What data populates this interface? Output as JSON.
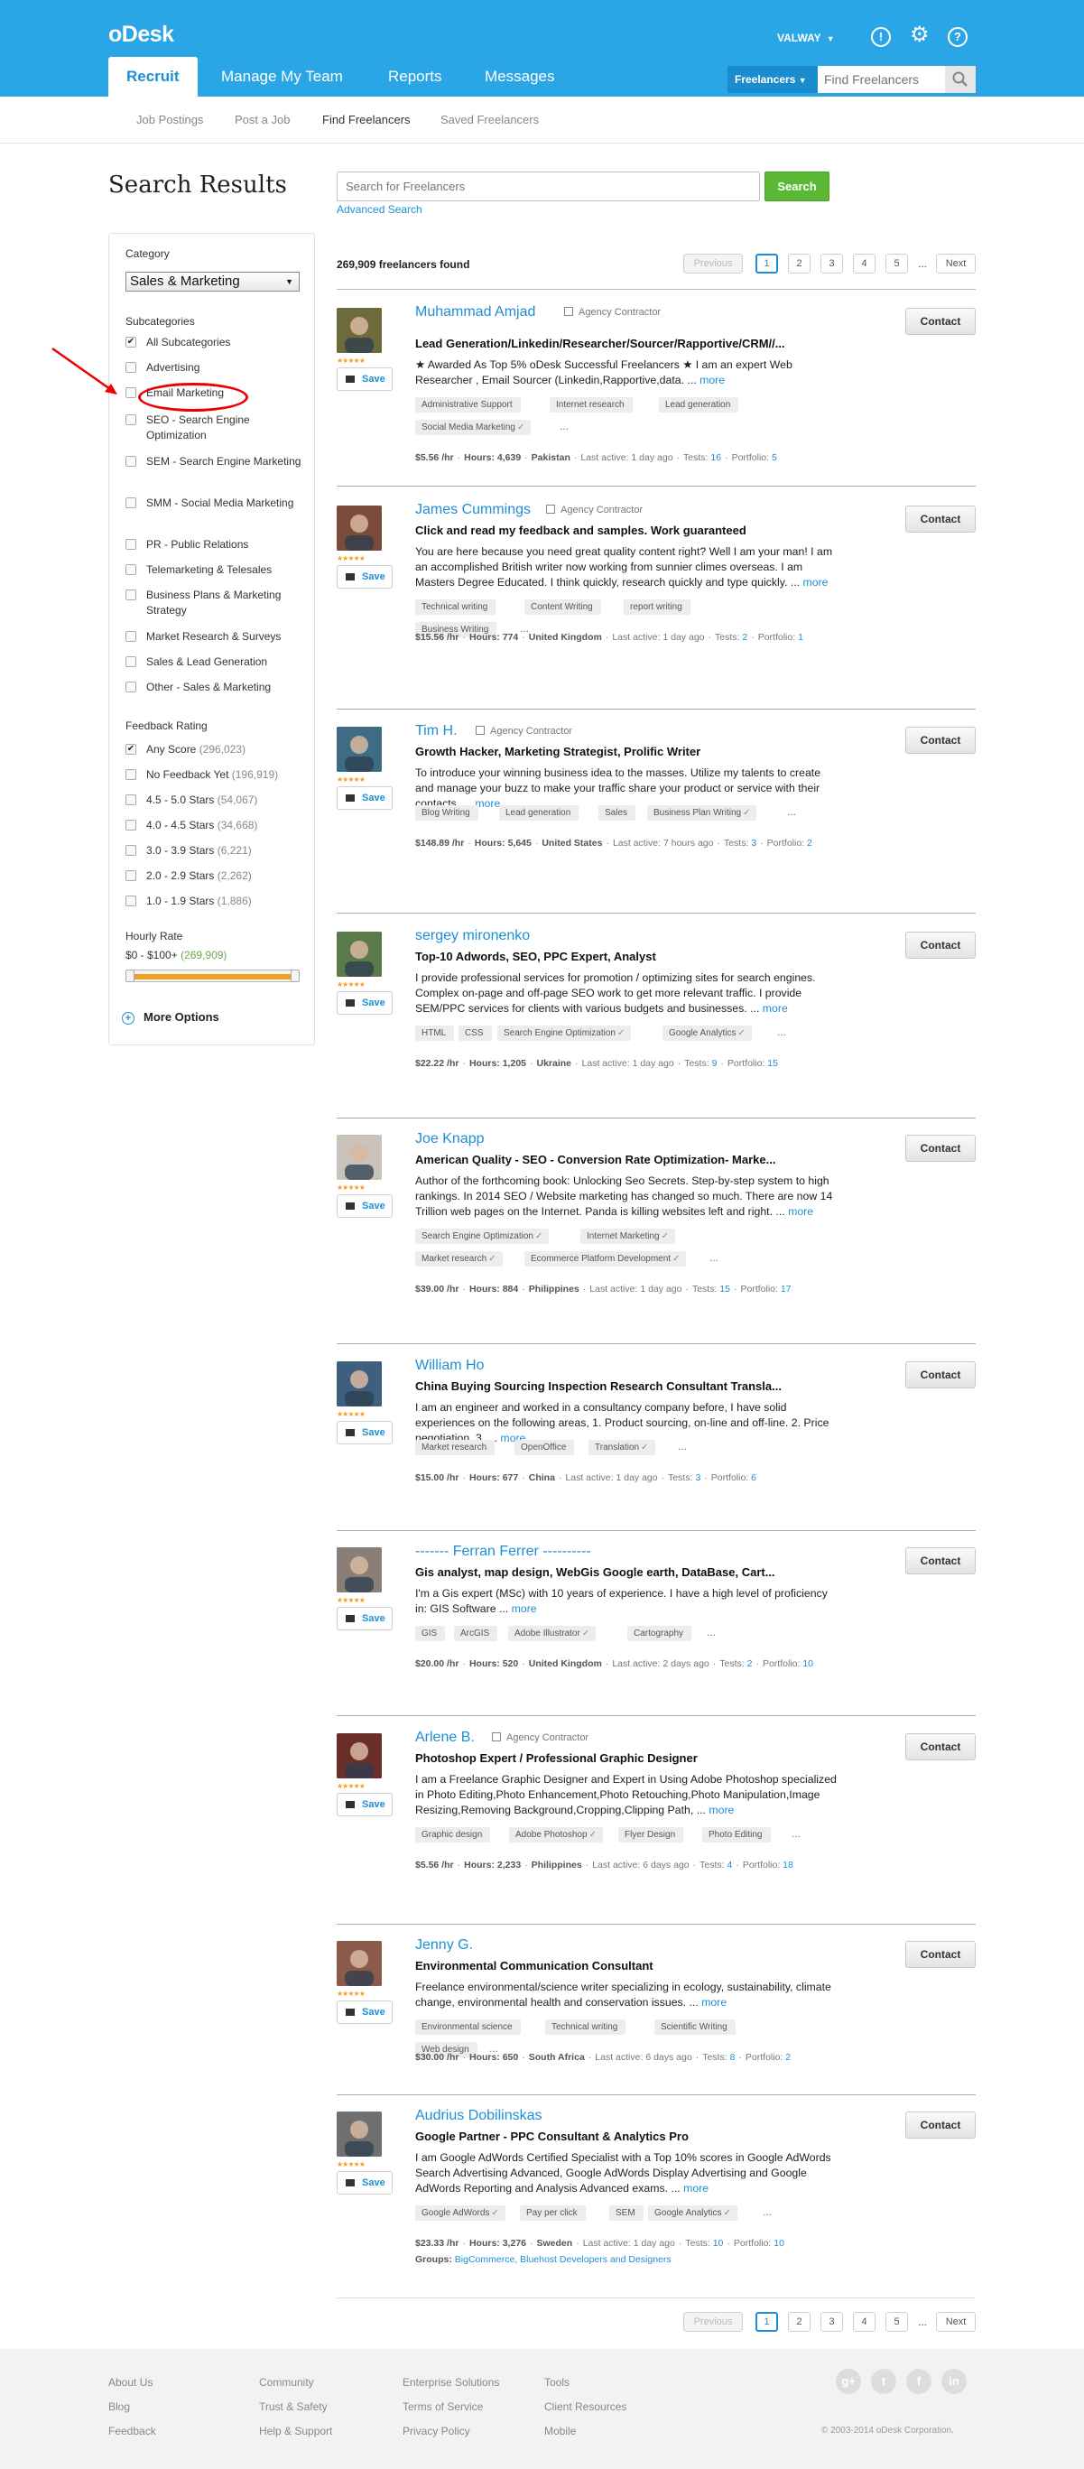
{
  "header": {
    "logo": "oDesk",
    "user": "VALWAY",
    "tabs": [
      "Recruit",
      "Manage My Team",
      "Reports",
      "Messages"
    ],
    "search_scope": "Freelancers",
    "search_placeholder": "Find Freelancers",
    "subnav": [
      "Job Postings",
      "Post a Job",
      "Find Freelancers",
      "Saved Freelancers"
    ]
  },
  "page": {
    "title": "Search Results",
    "search_placeholder": "Search for Freelancers",
    "search_button": "Search",
    "advanced": "Advanced Search",
    "found": "269,909 freelancers found"
  },
  "pagination": {
    "previous": "Previous",
    "pages": [
      "1",
      "2",
      "3",
      "4",
      "5"
    ],
    "ellipsis": "...",
    "next": "Next"
  },
  "sidebar": {
    "category_label": "Category",
    "category_value": "Sales & Marketing",
    "subcategories_label": "Subcategories",
    "subcategories": [
      {
        "label": "All Subcategories",
        "checked": "✔"
      },
      {
        "label": "Advertising",
        "checked": ""
      },
      {
        "label": "Email Marketing",
        "checked": ""
      },
      {
        "label": "SEO - Search Engine Optimization",
        "checked": ""
      },
      {
        "label": "SEM - Search Engine Marketing",
        "checked": ""
      },
      {
        "label": "SMM - Social Media Marketing",
        "checked": ""
      },
      {
        "label": "PR - Public Relations",
        "checked": ""
      },
      {
        "label": "Telemarketing & Telesales",
        "checked": ""
      },
      {
        "label": "Business Plans & Marketing Strategy",
        "checked": ""
      },
      {
        "label": "Market Research & Surveys",
        "checked": ""
      },
      {
        "label": "Sales & Lead Generation",
        "checked": ""
      },
      {
        "label": "Other - Sales & Marketing",
        "checked": ""
      }
    ],
    "feedback_label": "Feedback Rating",
    "feedback": [
      {
        "label": "Any Score",
        "count": "(296,023)",
        "checked": "✔"
      },
      {
        "label": "No Feedback Yet",
        "count": "(196,919)",
        "checked": ""
      },
      {
        "label": "4.5 - 5.0 Stars",
        "count": "(54,067)",
        "checked": ""
      },
      {
        "label": "4.0 - 4.5 Stars",
        "count": "(34,668)",
        "checked": ""
      },
      {
        "label": "3.0 - 3.9 Stars",
        "count": "(6,221)",
        "checked": ""
      },
      {
        "label": "2.0 - 2.9 Stars",
        "count": "(2,262)",
        "checked": ""
      },
      {
        "label": "1.0 - 1.9 Stars",
        "count": "(1,886)",
        "checked": ""
      }
    ],
    "hourly_label": "Hourly Rate",
    "hourly_range": "$0 - $100+",
    "hourly_count": "(269,909)",
    "more_options": "More Options"
  },
  "labels": {
    "save": "Save",
    "contact": "Contact",
    "stars": "★★★★★",
    "more": "more",
    "agency": "Agency Contractor",
    "hours": "Hours:",
    "last_active": "Last active:",
    "tests": "Tests:",
    "portfolio": "Portfolio:",
    "groups": "Groups:"
  },
  "results": [
    {
      "name": "Muhammad Amjad",
      "agency": true,
      "headline": "Lead Generation/Linkedin/Researcher/Sourcer/Rapportive/CRM//...",
      "desc": "★ Awarded As Top 5% oDesk Successful Freelancers ★ I am an expert Web Researcher , Email Sourcer (Linkedin,Rapportive,data. ...",
      "skills": [
        {
          "t": "Administrative Support",
          "c": ""
        },
        {
          "t": "Internet research",
          "c": ""
        },
        {
          "t": "Lead generation",
          "c": ""
        },
        {
          "t": "Social Media Marketing",
          "c": "✓"
        }
      ],
      "rate": "$5.56 /hr",
      "hours": "4,639",
      "country": "Pakistan",
      "active": "1 day ago",
      "tests": "16",
      "portfolio": "5",
      "groups": "",
      "groups_value": "",
      "avatar": "#6d6a3b"
    },
    {
      "name": "James Cummings",
      "agency": true,
      "headline": "Click and read my feedback and samples. Work guaranteed",
      "desc": "You are here because you need great quality content right? Well I am your man! I am an accomplished British writer now working from sunnier climes overseas. I am Masters Degree Educated. I think quickly, research quickly and type quickly. ...",
      "skills": [
        {
          "t": "Technical writing",
          "c": ""
        },
        {
          "t": "Content Writing",
          "c": ""
        },
        {
          "t": "report writing",
          "c": ""
        },
        {
          "t": "Business Writing",
          "c": ""
        }
      ],
      "rate": "$15.56 /hr",
      "hours": "774",
      "country": "United Kingdom",
      "active": "1 day ago",
      "tests": "2",
      "portfolio": "1",
      "groups": "",
      "groups_value": "",
      "avatar": "#7a4b3a"
    },
    {
      "name": "Tim H.",
      "agency": true,
      "headline": "Growth Hacker, Marketing Strategist, Prolific Writer",
      "desc": "To introduce your winning business idea to the masses. Utilize my talents to create and manage your buzz to make your traffic share your product or service with their contacts. ...",
      "skills": [
        {
          "t": "Blog Writing",
          "c": ""
        },
        {
          "t": "Lead generation",
          "c": ""
        },
        {
          "t": "Sales",
          "c": ""
        },
        {
          "t": "Business Plan Writing",
          "c": "✓"
        }
      ],
      "rate": "$148.89 /hr",
      "hours": "5,645",
      "country": "United States",
      "active": "7 hours ago",
      "tests": "3",
      "portfolio": "2",
      "groups": "",
      "groups_value": "",
      "avatar": "#3f6b84"
    },
    {
      "name": "sergey mironenko",
      "agency": false,
      "headline": "Top-10 Adwords, SEO, PPC Expert, Analyst",
      "desc": "I provide professional services for promotion / optimizing sites for search engines. Complex on-page and off-page SEO work to get more relevant traffic. I provide SEM/PPC services for clients with various budgets and businesses. ...",
      "skills": [
        {
          "t": "HTML",
          "c": ""
        },
        {
          "t": "CSS",
          "c": ""
        },
        {
          "t": "Search Engine Optimization",
          "c": "✓"
        },
        {
          "t": "Google Analytics",
          "c": "✓"
        }
      ],
      "rate": "$22.22 /hr",
      "hours": "1,205",
      "country": "Ukraine",
      "active": "1 day ago",
      "tests": "9",
      "portfolio": "15",
      "groups": "",
      "groups_value": "",
      "avatar": "#5b7a4a"
    },
    {
      "name": "Joe Knapp",
      "agency": false,
      "headline": "American Quality - SEO - Conversion Rate Optimization- Marke...",
      "desc": "Author of the forthcoming book: Unlocking Seo Secrets. Step-by-step system to high rankings. In 2014 SEO / Website marketing has changed so much. There are now 14 Trillion web pages on the Internet. Panda is killing websites left and right. ...",
      "skills": [
        {
          "t": "Search Engine Optimization",
          "c": "✓"
        },
        {
          "t": "Internet Marketing",
          "c": "✓"
        },
        {
          "t": "Market research",
          "c": "✓"
        },
        {
          "t": "Ecommerce Platform Development",
          "c": "✓"
        }
      ],
      "rate": "$39.00 /hr",
      "hours": "884",
      "country": "Philippines",
      "active": "1 day ago",
      "tests": "15",
      "portfolio": "17",
      "groups": "",
      "groups_value": "",
      "avatar": "#c9c3bb"
    },
    {
      "name": "William Ho",
      "agency": false,
      "headline": "China Buying Sourcing Inspection Research Consultant Transla...",
      "desc": "I am an engineer and worked in a consultancy company before, I have solid experiences on the following areas, 1. Product sourcing, on-line and off-line. 2. Price negotiation. 3. ...",
      "skills": [
        {
          "t": "Market research",
          "c": ""
        },
        {
          "t": "OpenOffice",
          "c": ""
        },
        {
          "t": "Translation",
          "c": "✓"
        }
      ],
      "rate": "$15.00 /hr",
      "hours": "677",
      "country": "China",
      "active": "1 day ago",
      "tests": "3",
      "portfolio": "6",
      "groups": "",
      "groups_value": "",
      "avatar": "#3e5f7e"
    },
    {
      "name": "------- Ferran Ferrer ----------",
      "agency": false,
      "headline": "Gis analyst, map design, WebGis Google earth, DataBase, Cart...",
      "desc": "I'm a Gis expert (MSc) with 10 years of experience. I have a high level of proficiency in: GIS Software ...",
      "skills": [
        {
          "t": "GIS",
          "c": ""
        },
        {
          "t": "ArcGIS",
          "c": ""
        },
        {
          "t": "Adobe Illustrator",
          "c": "✓"
        },
        {
          "t": "Cartography",
          "c": ""
        }
      ],
      "rate": "$20.00 /hr",
      "hours": "520",
      "country": "United Kingdom",
      "active": "2 days ago",
      "tests": "2",
      "portfolio": "10",
      "groups": "",
      "groups_value": "",
      "avatar": "#8a7f78"
    },
    {
      "name": "Arlene B.",
      "agency": true,
      "headline": "Photoshop Expert / Professional Graphic Designer",
      "desc": "I am a Freelance Graphic Designer and Expert in Using Adobe Photoshop specialized in Photo Editing,Photo Enhancement,Photo Retouching,Photo Manipulation,Image Resizing,Removing Background,Cropping,Clipping Path, ...",
      "skills": [
        {
          "t": "Graphic design",
          "c": ""
        },
        {
          "t": "Adobe Photoshop",
          "c": "✓"
        },
        {
          "t": "Flyer Design",
          "c": ""
        },
        {
          "t": "Photo Editing",
          "c": ""
        }
      ],
      "rate": "$5.56 /hr",
      "hours": "2,233",
      "country": "Philippines",
      "active": "6 days ago",
      "tests": "4",
      "portfolio": "18",
      "groups": "",
      "groups_value": "",
      "avatar": "#6b2f2a"
    },
    {
      "name": "Jenny G.",
      "agency": false,
      "headline": "Environmental Communication Consultant",
      "desc": "Freelance environmental/science writer specializing in ecology, sustainability, climate change, environmental health and conservation issues. ...",
      "skills": [
        {
          "t": "Environmental science",
          "c": ""
        },
        {
          "t": "Technical writing",
          "c": ""
        },
        {
          "t": "Scientific Writing",
          "c": ""
        },
        {
          "t": "Web design",
          "c": ""
        }
      ],
      "rate": "$30.00 /hr",
      "hours": "650",
      "country": "South Africa",
      "active": "6 days ago",
      "tests": "8",
      "portfolio": "2",
      "groups": "",
      "groups_value": "",
      "avatar": "#8a5a4a"
    },
    {
      "name": "Audrius Dobilinskas",
      "agency": false,
      "headline": "Google Partner - PPC Consultant & Analytics Pro",
      "desc": "I am Google AdWords Certified Specialist with a Top 10% scores in Google AdWords Search Advertising Advanced, Google AdWords Display Advertising and Google AdWords Reporting and Analysis Advanced exams. ...",
      "skills": [
        {
          "t": "Google AdWords",
          "c": "✓"
        },
        {
          "t": "Pay per click",
          "c": ""
        },
        {
          "t": "SEM",
          "c": ""
        },
        {
          "t": "Google Analytics",
          "c": "✓"
        }
      ],
      "rate": "$23.33 /hr",
      "hours": "3,276",
      "country": "Sweden",
      "active": "1 day ago",
      "tests": "10",
      "portfolio": "10",
      "groups": "Groups:",
      "groups_value": "BigCommerce, Bluehost Developers and Designers",
      "avatar": "#6f6f6f"
    }
  ],
  "footer": {
    "col1": [
      "About Us",
      "Blog",
      "Feedback"
    ],
    "col2": [
      "Community",
      "Trust & Safety",
      "Help & Support"
    ],
    "col3": [
      "Enterprise Solutions",
      "Terms of Service",
      "Privacy Policy"
    ],
    "col4": [
      "Tools",
      "Client Resources",
      "Mobile"
    ],
    "social": [
      "g+",
      "t",
      "f",
      "in"
    ],
    "copyright": "© 2003-2014 oDesk Corporation."
  }
}
